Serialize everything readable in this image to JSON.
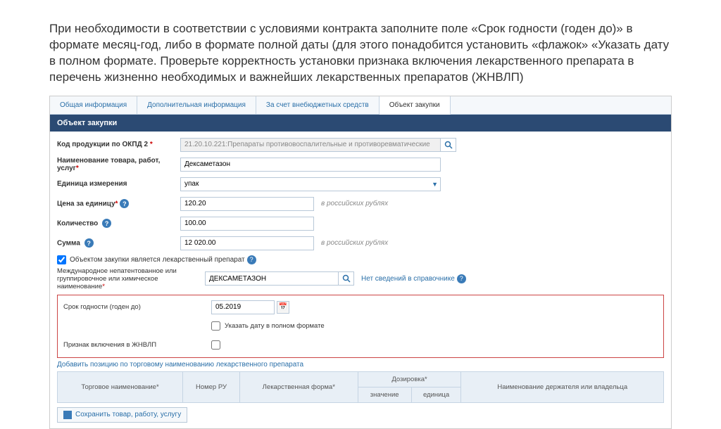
{
  "instruction": "При необходимости в соответствии с условиями контракта заполните поле «Срок годности (годен до)» в формате месяц-год, либо в формате полной даты (для этого понадобится установить «флажок» «Указать дату в полном формате. Проверьте корректность установки признака включения лекарственного препарата в перечень жизненно необходимых и важнейших лекарственных препаратов (ЖНВЛП)",
  "tabs": {
    "t0": "Общая информация",
    "t1": "Дополнительная информация",
    "t2": "За счет внебюджетных средств",
    "t3": "Объект закупки"
  },
  "section_title": "Объект закупки",
  "labels": {
    "okpd": "Код продукции по ОКПД 2",
    "name": "Наименование товара, работ, услуг",
    "unit": "Единица измерения",
    "price": "Цена за единицу",
    "qty": "Количество",
    "sum": "Сумма",
    "is_drug": "Объектом закупки является лекарственный препарат",
    "intl_name": "Международное непатентованное или группировочное или химическое наименование",
    "expiry": "Срок годности (годен до)",
    "full_date": "Указать дату в полном формате",
    "jnvlp": "Признак включения в ЖНВЛП",
    "add_link": "Добавить позицию по торговому наименованию лекарственного препарата",
    "no_ref": "Нет сведений в справочнике"
  },
  "values": {
    "okpd": "21.20.10.221:Препараты противовоспалительные и противоревматические",
    "name": "Дексаметазон",
    "unit": "упак",
    "price": "120.20",
    "qty": "100.00",
    "sum": "12 020.00",
    "intl_name": "ДЕКСАМЕТАЗОН",
    "expiry": "05.2019"
  },
  "hints": {
    "rub": "в российских рублях"
  },
  "table": {
    "trade_name": "Торговое наименование",
    "reg_num": "Номер РУ",
    "form": "Лекарственная форма",
    "dosage": "Дозировка",
    "dose_val": "значение",
    "dose_unit": "единица",
    "holder": "Наименование держателя или владельца"
  },
  "save_btn": "Сохранить товар, работу, услугу"
}
